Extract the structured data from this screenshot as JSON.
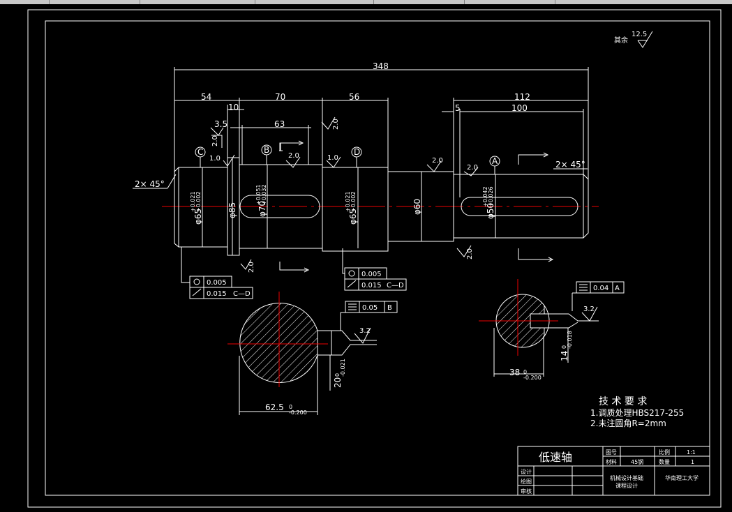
{
  "app": {
    "accent": "#ffffff",
    "centerline_color": "#e00000",
    "background": "#000000"
  },
  "drawing": {
    "rough_note": "其余",
    "rough_note_value": "12.5",
    "dims": {
      "overall": "348",
      "d54": "54",
      "d70": "70",
      "d56": "56",
      "d112": "112",
      "d10": "10",
      "d100": "100",
      "d5": "5",
      "d35": "3.5",
      "d63": "63",
      "chamfer_left": "2× 45°",
      "chamfer_right": "2× 45°",
      "dia65a": "φ65",
      "dia85": "φ85",
      "dia70": "φ70",
      "dia65b": "φ65",
      "dia60": "φ60",
      "dia50": "φ50",
      "tol65a": "+0.021\n+0.002",
      "tol70": "+0.051\n+0.032",
      "tol65b": "+0.021\n+0.002",
      "tol50": "+0.042\n+0.026",
      "sec1_width": "62.5",
      "sec1_width_tol": "0\n-0.200",
      "sec1_key": "20",
      "sec1_key_tol": "0\n-0.021",
      "sec2_width": "38",
      "sec2_width_tol": "0\n-0.200",
      "sec2_key": "14",
      "sec2_key_tol": "0\n-0.018"
    },
    "rough": {
      "r1": "2.0",
      "r2": "2.0",
      "r3": "2.0",
      "r4": "1.0",
      "r5": "2.0",
      "r6": "1.0",
      "r7": "2.0",
      "r8": "2.0",
      "r9": "2.0",
      "r10": "2.0",
      "r11": "3.2",
      "r12": "3.2"
    },
    "datums": {
      "c": "C",
      "b": "B",
      "d": "D",
      "a": "A"
    },
    "fcf1": {
      "v1": "0.005",
      "v2": "0.015",
      "ref2": "C—D"
    },
    "fcf2": {
      "v1": "0.005",
      "v2": "0.015",
      "ref2": "C—D"
    },
    "fcf3": {
      "v": "0.05",
      "ref": "B"
    },
    "fcf4": {
      "v": "0.04",
      "ref": "A"
    },
    "notes": {
      "title": "技 术 要 求",
      "n1": "1.调质处理HBS217-255",
      "n2": "2.未注圆角R=2mm"
    },
    "title_block": {
      "part_name": "低速轴",
      "tuhao": "图号",
      "bili": "比例",
      "bili_val": "1:1",
      "cailiao": "材料",
      "cailiao_val": "45钢",
      "shuliang": "数量",
      "shuliang_val": "1",
      "sheji": "设计",
      "huitu": "绘图",
      "shenhe": "审核",
      "course1": "机械设计基础",
      "course2": "课程设计",
      "school": "华南理工大学"
    }
  }
}
